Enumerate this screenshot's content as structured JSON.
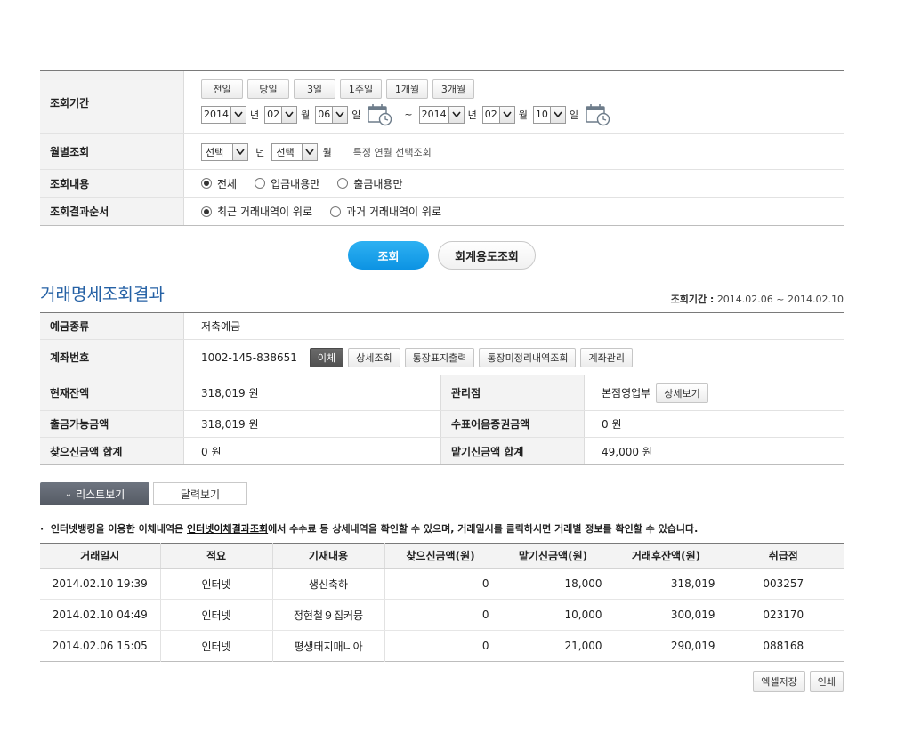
{
  "search": {
    "period_label": "조회기간",
    "period_buttons": [
      "전일",
      "당일",
      "3일",
      "1주일",
      "1개월",
      "3개월"
    ],
    "from": {
      "year": "2014",
      "month": "02",
      "day": "06"
    },
    "to": {
      "year": "2014",
      "month": "02",
      "day": "10"
    },
    "unit_year": "년",
    "unit_month": "월",
    "unit_day": "일",
    "tilde": "~",
    "monthly_label": "월별조회",
    "monthly_year": "선택",
    "monthly_month": "선택",
    "monthly_hint": "특정 연월 선택조회",
    "content_label": "조회내용",
    "content_options": [
      "전체",
      "입금내용만",
      "출금내용만"
    ],
    "order_label": "조회결과순서",
    "order_options": [
      "최근 거래내역이 위로",
      "과거 거래내역이 위로"
    ]
  },
  "actions": {
    "search": "조회",
    "accounting": "회계용도조회"
  },
  "result": {
    "title": "거래명세조회결과",
    "period_label": "조회기간 :",
    "period_value": "2014.02.06 ~ 2014.02.10"
  },
  "info": {
    "deposit_type_label": "예금종류",
    "deposit_type": "저축예금",
    "account_label": "계좌번호",
    "account": "1002-145-838651",
    "account_buttons": [
      "이체",
      "상세조회",
      "통장표지출력",
      "통장미정리내역조회",
      "계좌관리"
    ],
    "balance_label": "현재잔액",
    "balance": "318,019 원",
    "branch_label": "관리점",
    "branch": "본점영업부",
    "branch_button": "상세보기",
    "available_label": "출금가능금액",
    "available": "318,019 원",
    "check_label": "수표어음증권금액",
    "check": "0 원",
    "withdraw_sum_label": "찾으신금액 합계",
    "withdraw_sum": "0 원",
    "deposit_sum_label": "맡기신금액 합계",
    "deposit_sum": "49,000 원"
  },
  "tabs": {
    "list": "리스트보기",
    "calendar": "달력보기"
  },
  "notice": {
    "prefix": "인터넷뱅킹을 이용한 이체내역은 ",
    "link": "인터넷이체결과조회",
    "suffix": "에서 수수료 등 상세내역을 확인할 수 있으며, 거래일시를 클릭하시면 거래별 정보를 확인할 수 있습니다."
  },
  "table": {
    "headers": [
      "거래일시",
      "적요",
      "기재내용",
      "찾으신금액(원)",
      "맡기신금액(원)",
      "거래후잔액(원)",
      "취급점"
    ],
    "rows": [
      [
        "2014.02.10 19:39",
        "인터넷",
        "생신축하",
        "0",
        "18,000",
        "318,019",
        "003257"
      ],
      [
        "2014.02.10 04:49",
        "인터넷",
        "정현철９집커뮹",
        "0",
        "10,000",
        "300,019",
        "023170"
      ],
      [
        "2014.02.06 15:05",
        "인터넷",
        "평생태지매니아",
        "0",
        "21,000",
        "290,019",
        "088168"
      ]
    ]
  },
  "bottom": {
    "excel": "엑셀저장",
    "print": "인쇄"
  }
}
